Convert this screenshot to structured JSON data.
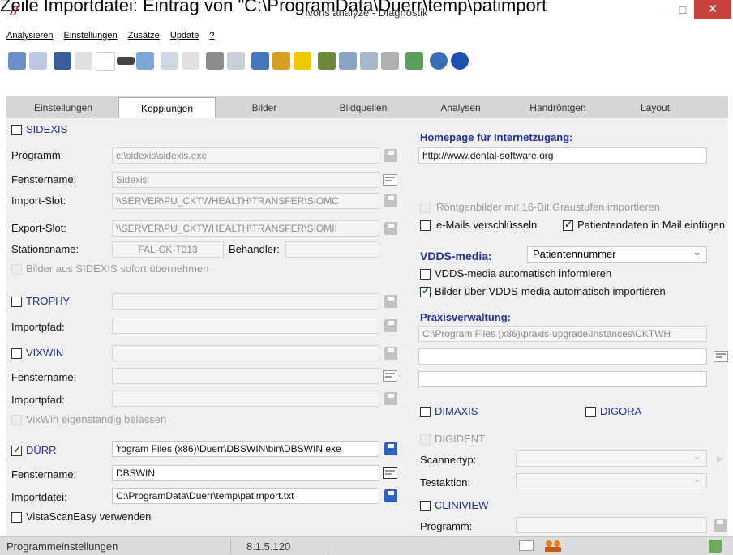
{
  "caption": "Zeile Importdatei: Eintrag von \"C:\\ProgramData\\Duerr\\temp\\patimport",
  "window": {
    "title": "ivoris analyze - Diagnostik",
    "minimize": "–",
    "maximize": "□",
    "close": "✕"
  },
  "menu": [
    "Analysieren",
    "Einstellungen",
    "Zusätze",
    "Update",
    "?"
  ],
  "tabs": [
    "Einstellungen",
    "Kopplungen",
    "Bilder",
    "Bildquellen",
    "Analysen",
    "Handröntgen",
    "Layout"
  ],
  "sidexis": {
    "title": "SIDEXIS",
    "programm_label": "Programm:",
    "programm_value": "c:\\sidexis\\sidexis.exe",
    "fenstername_label": "Fenstername:",
    "fenstername_value": "Sidexis",
    "import_label": "Import-Slot:",
    "import_value": "\\\\SERVER\\PU_CKTWHEALTH\\TRANSFER\\SIOMC",
    "export_label": "Export-Slot:",
    "export_value": "\\\\SERVER\\PU_CKTWHEALTH\\TRANSFER\\SIOMII",
    "station_label": "Stationsname:",
    "station_value": "FAL-CK-T013",
    "behandler_label": "Behandler:",
    "behandler_value": "",
    "sofort_label": "Bilder aus SIDEXIS sofort übernehmen"
  },
  "trophy": {
    "title": "TROPHY",
    "import_label": "Importpfad:"
  },
  "vixwin": {
    "title": "VIXWIN",
    "fenster_label": "Fenstername:",
    "import_label": "Importpfad:",
    "belassen_label": "VixWin eigenständig belassen"
  },
  "duerr": {
    "title": "DÜRR",
    "checked": true,
    "path_value": "'rogram Files (x86)\\Duerr\\DBSWIN\\bin\\DBSWIN.exe",
    "fenster_label": "Fenstername:",
    "fenster_value": "DBSWIN",
    "import_label": "Importdatei:",
    "import_value": "C:\\ProgramData\\Duerr\\temp\\patimport.txt",
    "vista_label": "VistaScanEasy verwenden"
  },
  "right": {
    "homepage_label": "Homepage für Internetzugang:",
    "homepage_value": "http://www.dental-software.org",
    "roentgen16_label": "Röntgenbilder mit 16-Bit Graustufen importieren",
    "email_label": "e-Mails verschlüsseln",
    "patmail_label": "Patientendaten in Mail einfügen",
    "vdds_label": "VDDS-media:",
    "vdds_select": "Patientennummer",
    "vdds_inform_label": "VDDS-media automatisch informieren",
    "vdds_import_label": "Bilder über VDDS-media automatisch importieren",
    "praxis_label": "Praxisverwaltung:",
    "praxis_value": "C:\\Program Files (x86)\\praxis-upgrade\\Instances\\CKTWH",
    "dimaxis_label": "DIMAXIS",
    "digora_label": "DIGORA",
    "digident_label": "DIGIDENT",
    "scanner_label": "Scannertyp:",
    "testaktion_label": "Testaktion:",
    "cliniview_label": "CLINIVIEW",
    "programm_label": "Programm:"
  },
  "status": {
    "left": "Programmeinstellungen",
    "version": "8.1.5.120"
  }
}
